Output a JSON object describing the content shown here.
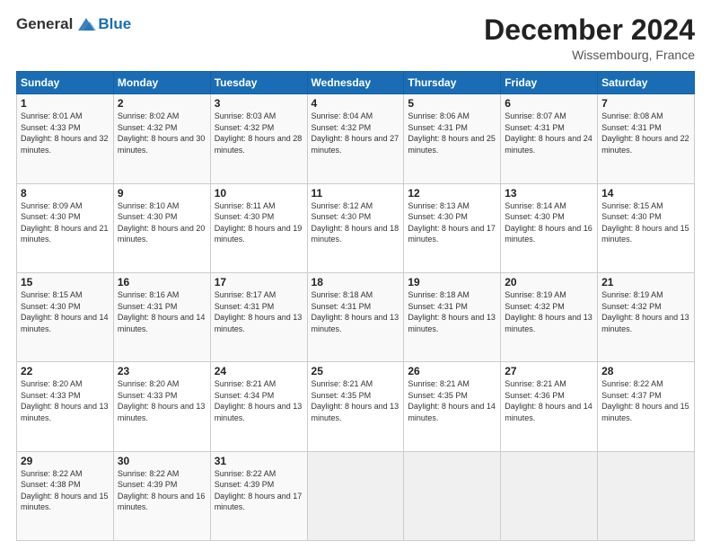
{
  "logo": {
    "general": "General",
    "blue": "Blue"
  },
  "header": {
    "month_year": "December 2024",
    "location": "Wissembourg, France"
  },
  "columns": [
    "Sunday",
    "Monday",
    "Tuesday",
    "Wednesday",
    "Thursday",
    "Friday",
    "Saturday"
  ],
  "weeks": [
    [
      {
        "day": "1",
        "sunrise": "Sunrise: 8:01 AM",
        "sunset": "Sunset: 4:33 PM",
        "daylight": "Daylight: 8 hours and 32 minutes."
      },
      {
        "day": "2",
        "sunrise": "Sunrise: 8:02 AM",
        "sunset": "Sunset: 4:32 PM",
        "daylight": "Daylight: 8 hours and 30 minutes."
      },
      {
        "day": "3",
        "sunrise": "Sunrise: 8:03 AM",
        "sunset": "Sunset: 4:32 PM",
        "daylight": "Daylight: 8 hours and 28 minutes."
      },
      {
        "day": "4",
        "sunrise": "Sunrise: 8:04 AM",
        "sunset": "Sunset: 4:32 PM",
        "daylight": "Daylight: 8 hours and 27 minutes."
      },
      {
        "day": "5",
        "sunrise": "Sunrise: 8:06 AM",
        "sunset": "Sunset: 4:31 PM",
        "daylight": "Daylight: 8 hours and 25 minutes."
      },
      {
        "day": "6",
        "sunrise": "Sunrise: 8:07 AM",
        "sunset": "Sunset: 4:31 PM",
        "daylight": "Daylight: 8 hours and 24 minutes."
      },
      {
        "day": "7",
        "sunrise": "Sunrise: 8:08 AM",
        "sunset": "Sunset: 4:31 PM",
        "daylight": "Daylight: 8 hours and 22 minutes."
      }
    ],
    [
      {
        "day": "8",
        "sunrise": "Sunrise: 8:09 AM",
        "sunset": "Sunset: 4:30 PM",
        "daylight": "Daylight: 8 hours and 21 minutes."
      },
      {
        "day": "9",
        "sunrise": "Sunrise: 8:10 AM",
        "sunset": "Sunset: 4:30 PM",
        "daylight": "Daylight: 8 hours and 20 minutes."
      },
      {
        "day": "10",
        "sunrise": "Sunrise: 8:11 AM",
        "sunset": "Sunset: 4:30 PM",
        "daylight": "Daylight: 8 hours and 19 minutes."
      },
      {
        "day": "11",
        "sunrise": "Sunrise: 8:12 AM",
        "sunset": "Sunset: 4:30 PM",
        "daylight": "Daylight: 8 hours and 18 minutes."
      },
      {
        "day": "12",
        "sunrise": "Sunrise: 8:13 AM",
        "sunset": "Sunset: 4:30 PM",
        "daylight": "Daylight: 8 hours and 17 minutes."
      },
      {
        "day": "13",
        "sunrise": "Sunrise: 8:14 AM",
        "sunset": "Sunset: 4:30 PM",
        "daylight": "Daylight: 8 hours and 16 minutes."
      },
      {
        "day": "14",
        "sunrise": "Sunrise: 8:15 AM",
        "sunset": "Sunset: 4:30 PM",
        "daylight": "Daylight: 8 hours and 15 minutes."
      }
    ],
    [
      {
        "day": "15",
        "sunrise": "Sunrise: 8:15 AM",
        "sunset": "Sunset: 4:30 PM",
        "daylight": "Daylight: 8 hours and 14 minutes."
      },
      {
        "day": "16",
        "sunrise": "Sunrise: 8:16 AM",
        "sunset": "Sunset: 4:31 PM",
        "daylight": "Daylight: 8 hours and 14 minutes."
      },
      {
        "day": "17",
        "sunrise": "Sunrise: 8:17 AM",
        "sunset": "Sunset: 4:31 PM",
        "daylight": "Daylight: 8 hours and 13 minutes."
      },
      {
        "day": "18",
        "sunrise": "Sunrise: 8:18 AM",
        "sunset": "Sunset: 4:31 PM",
        "daylight": "Daylight: 8 hours and 13 minutes."
      },
      {
        "day": "19",
        "sunrise": "Sunrise: 8:18 AM",
        "sunset": "Sunset: 4:31 PM",
        "daylight": "Daylight: 8 hours and 13 minutes."
      },
      {
        "day": "20",
        "sunrise": "Sunrise: 8:19 AM",
        "sunset": "Sunset: 4:32 PM",
        "daylight": "Daylight: 8 hours and 13 minutes."
      },
      {
        "day": "21",
        "sunrise": "Sunrise: 8:19 AM",
        "sunset": "Sunset: 4:32 PM",
        "daylight": "Daylight: 8 hours and 13 minutes."
      }
    ],
    [
      {
        "day": "22",
        "sunrise": "Sunrise: 8:20 AM",
        "sunset": "Sunset: 4:33 PM",
        "daylight": "Daylight: 8 hours and 13 minutes."
      },
      {
        "day": "23",
        "sunrise": "Sunrise: 8:20 AM",
        "sunset": "Sunset: 4:33 PM",
        "daylight": "Daylight: 8 hours and 13 minutes."
      },
      {
        "day": "24",
        "sunrise": "Sunrise: 8:21 AM",
        "sunset": "Sunset: 4:34 PM",
        "daylight": "Daylight: 8 hours and 13 minutes."
      },
      {
        "day": "25",
        "sunrise": "Sunrise: 8:21 AM",
        "sunset": "Sunset: 4:35 PM",
        "daylight": "Daylight: 8 hours and 13 minutes."
      },
      {
        "day": "26",
        "sunrise": "Sunrise: 8:21 AM",
        "sunset": "Sunset: 4:35 PM",
        "daylight": "Daylight: 8 hours and 14 minutes."
      },
      {
        "day": "27",
        "sunrise": "Sunrise: 8:21 AM",
        "sunset": "Sunset: 4:36 PM",
        "daylight": "Daylight: 8 hours and 14 minutes."
      },
      {
        "day": "28",
        "sunrise": "Sunrise: 8:22 AM",
        "sunset": "Sunset: 4:37 PM",
        "daylight": "Daylight: 8 hours and 15 minutes."
      }
    ],
    [
      {
        "day": "29",
        "sunrise": "Sunrise: 8:22 AM",
        "sunset": "Sunset: 4:38 PM",
        "daylight": "Daylight: 8 hours and 15 minutes."
      },
      {
        "day": "30",
        "sunrise": "Sunrise: 8:22 AM",
        "sunset": "Sunset: 4:39 PM",
        "daylight": "Daylight: 8 hours and 16 minutes."
      },
      {
        "day": "31",
        "sunrise": "Sunrise: 8:22 AM",
        "sunset": "Sunset: 4:39 PM",
        "daylight": "Daylight: 8 hours and 17 minutes."
      },
      null,
      null,
      null,
      null
    ]
  ]
}
